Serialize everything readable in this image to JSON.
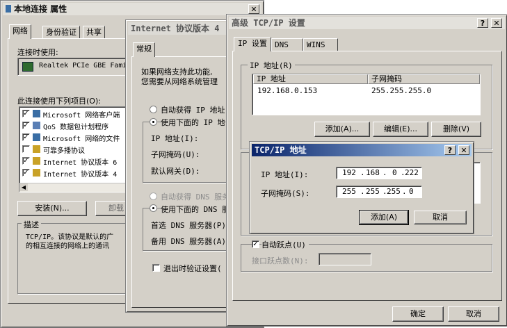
{
  "props_window": {
    "title": "本地连接 属性",
    "tabs": [
      "网络",
      "身份验证",
      "共享"
    ],
    "connect_using_label": "连接时使用:",
    "adapter": "Realtek PCIe GBE Fami",
    "items_label": "此连接使用下列项目(O):",
    "items": [
      {
        "label": "Microsoft 网络客户端",
        "checked": true
      },
      {
        "label": "QoS 数据包计划程序",
        "checked": true
      },
      {
        "label": "Microsoft 网络的文件",
        "checked": true
      },
      {
        "label": "可靠多播协议",
        "checked": false
      },
      {
        "label": "Internet 协议版本 6",
        "checked": true
      },
      {
        "label": "Internet 协议版本 4",
        "checked": true
      }
    ],
    "install_button": "安装(N)...",
    "uninstall_button": "卸载",
    "description_title": "描述",
    "description_text_1": "TCP/IP。该协议是默认的广",
    "description_text_2": "的相互连接的网络上的通讯"
  },
  "ipv4_window": {
    "title": "Internet 协议版本 4",
    "tab": "常规",
    "intro_1": "如果网络支持此功能,",
    "intro_2": "您需要从网络系统管理",
    "auto_ip": "自动获得 IP 地址",
    "manual_ip": "使用下面的 IP 地",
    "ip_label": "IP 地址(I):",
    "mask_label": "子网掩码(U):",
    "gateway_label": "默认网关(D):",
    "auto_dns": "自动获得 DNS 服务",
    "manual_dns": "使用下面的 DNS 服",
    "pref_dns": "首选 DNS 服务器(P)",
    "alt_dns": "备用 DNS 服务器(A)",
    "validate": "退出时验证设置("
  },
  "advanced_window": {
    "title": "高级 TCP/IP 设置",
    "tabs": [
      "IP 设置",
      "DNS",
      "WINS"
    ],
    "ip_group_title": "IP 地址(R)",
    "col_ip": "IP 地址",
    "col_mask": "子网掩码",
    "rows": [
      {
        "ip": "192.168.0.153",
        "mask": "255.255.255.0"
      }
    ],
    "add_button": "添加(A)...",
    "edit_button": "编辑(E)...",
    "delete_button": "删除(V)",
    "auto_metric": "自动跃点(U)",
    "metric_label": "接口跃点数(N):",
    "ok_button": "确定",
    "cancel_button": "取消"
  },
  "addr_dialog": {
    "title": "TCP/IP 地址",
    "ip_label": "IP 地址(I):",
    "mask_label": "子网掩码(S):",
    "ip_octets": [
      "192",
      "168",
      "0",
      "222"
    ],
    "mask_octets": [
      "255",
      "255",
      "255",
      "0"
    ],
    "add_button": "添加(A)",
    "cancel_button": "取消"
  }
}
